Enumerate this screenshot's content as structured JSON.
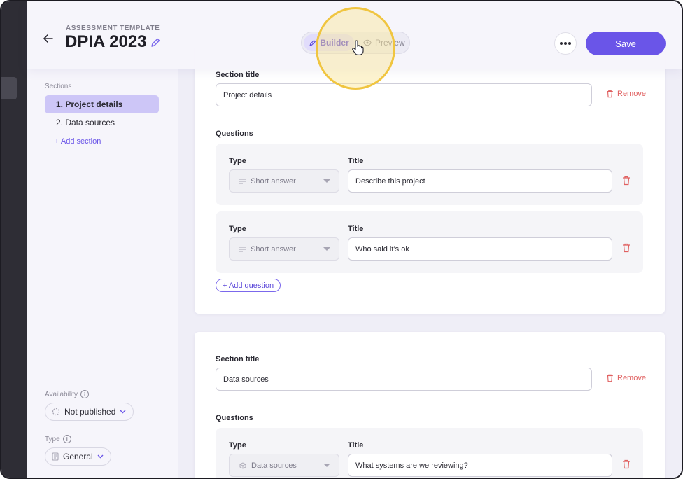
{
  "header": {
    "eyebrow": "ASSESSMENT TEMPLATE",
    "title": "DPIA 2023",
    "toggle": {
      "builder_label": "Builder",
      "preview_label": "Preview"
    },
    "save_label": "Save"
  },
  "sidebar": {
    "sections_label": "Sections",
    "items": [
      {
        "label": "1. Project details",
        "active": true
      },
      {
        "label": "2. Data sources",
        "active": false
      }
    ],
    "add_section_label": "+ Add section",
    "availability": {
      "label": "Availability",
      "value": "Not published"
    },
    "type": {
      "label": "Type",
      "value": "General"
    }
  },
  "sections": [
    {
      "section_title_label": "Section title",
      "section_title_value": "Project details",
      "remove_label": "Remove",
      "questions_label": "Questions",
      "questions": [
        {
          "type_label": "Type",
          "type_value": "Short answer",
          "title_label": "Title",
          "title_value": "Describe this project"
        },
        {
          "type_label": "Type",
          "type_value": "Short answer",
          "title_label": "Title",
          "title_value": "Who said it’s ok"
        }
      ],
      "add_question_label": "+ Add question"
    },
    {
      "section_title_label": "Section title",
      "section_title_value": "Data sources",
      "remove_label": "Remove",
      "questions_label": "Questions",
      "questions": [
        {
          "type_label": "Type",
          "type_value": "Data sources",
          "title_label": "Title",
          "title_value": "What systems are we reviewing?"
        }
      ]
    }
  ],
  "colors": {
    "accent": "#6a55e8",
    "danger": "#e06060",
    "highlight_ring": "#f0c540"
  },
  "icons": [
    "back-arrow-icon",
    "pencil-icon",
    "eye-icon",
    "hand-cursor-icon",
    "more-dots-icon",
    "trash-icon",
    "lines-icon",
    "cube-icon",
    "info-icon",
    "chevron-down-icon",
    "dashed-circle-icon",
    "document-icon"
  ]
}
